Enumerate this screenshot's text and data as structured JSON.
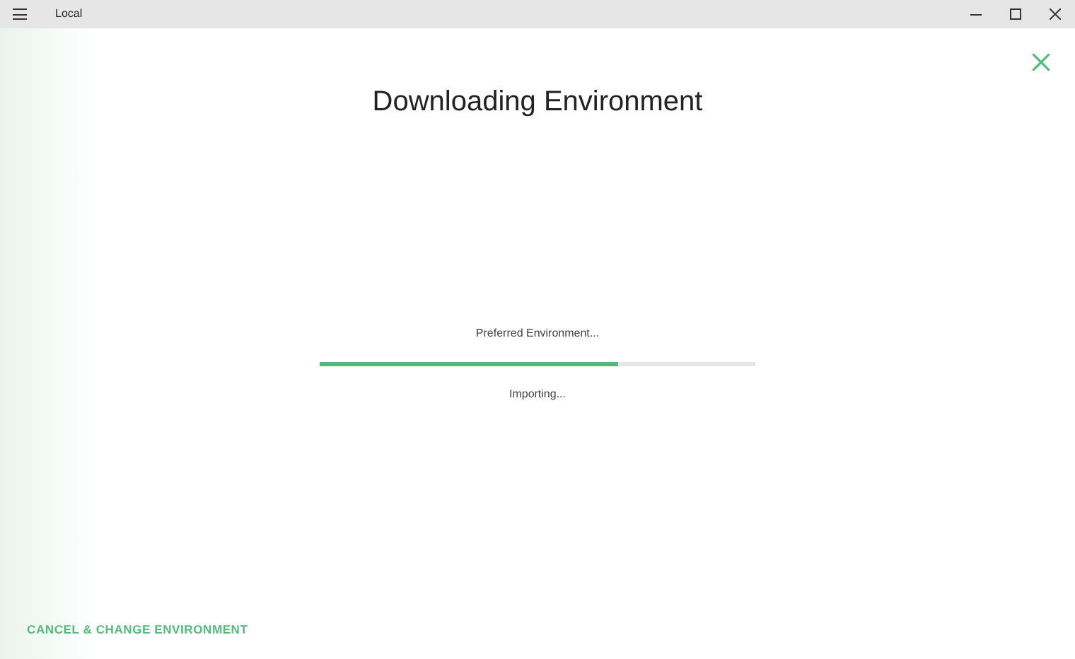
{
  "window": {
    "title": "Local"
  },
  "heading": "Downloading Environment",
  "progress": {
    "label": "Preferred Environment...",
    "level": 0.685,
    "status": "Importing..."
  },
  "footer_link": "CANCEL & CHANGE ENVIRONMENT"
}
